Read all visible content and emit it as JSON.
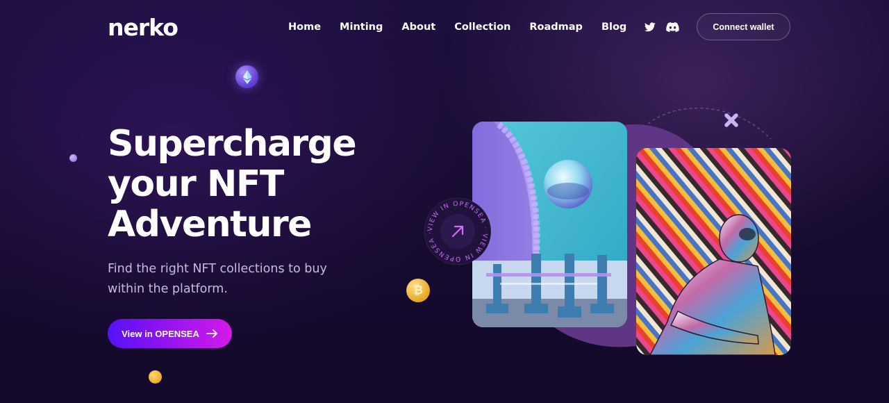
{
  "brand": {
    "logo_text": "nerko"
  },
  "nav": {
    "items": [
      {
        "label": "Home"
      },
      {
        "label": "Minting"
      },
      {
        "label": "About"
      },
      {
        "label": "Collection"
      },
      {
        "label": "Roadmap"
      },
      {
        "label": "Blog"
      }
    ]
  },
  "social": {
    "icons": [
      "twitter-icon",
      "discord-icon"
    ]
  },
  "header": {
    "connect_label": "Connect wallet"
  },
  "hero": {
    "headline_line1": "Supercharge",
    "headline_line2": "your NFT",
    "headline_line3": "Adventure",
    "subtitle": "Find the right NFT collections to buy within the platform.",
    "cta_label": "View in OPENSEA"
  },
  "badge": {
    "circular_text": "VIEW IN OPENSEA · VIEW IN OPENSEA · "
  },
  "colors": {
    "background": "#1a0e38",
    "cta_gradient_start": "#5611f5",
    "cta_gradient_end": "#d41ae8",
    "blob": "#5e3684",
    "badge_text": "#c86bf0"
  }
}
